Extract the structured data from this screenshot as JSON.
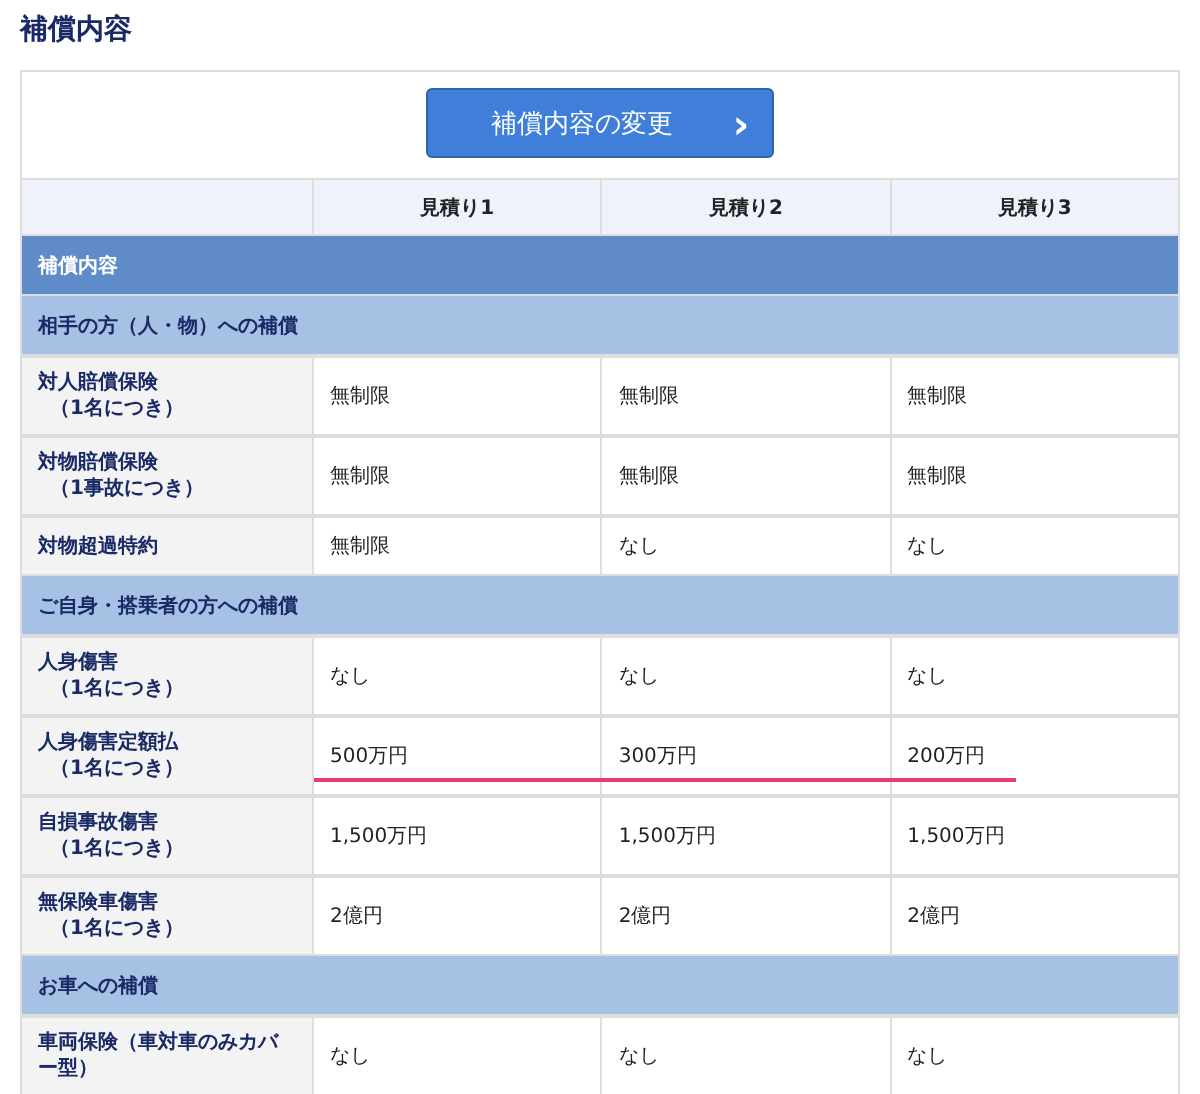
{
  "title": "補償内容",
  "change_button": {
    "label": "補償内容の変更",
    "icon": "›"
  },
  "columns": [
    "見積り1",
    "見積り2",
    "見積り3"
  ],
  "rows": [
    {
      "kind": "section",
      "label": "補償内容"
    },
    {
      "kind": "group",
      "label": "相手の方（人・物）への補償"
    },
    {
      "kind": "item",
      "label": "対人賠償保険",
      "note": "（1名につき）",
      "values": [
        "無制限",
        "無制限",
        "無制限"
      ]
    },
    {
      "kind": "item",
      "label": "対物賠償保険",
      "note": "（1事故につき）",
      "values": [
        "無制限",
        "無制限",
        "無制限"
      ]
    },
    {
      "kind": "item",
      "label": "対物超過特約",
      "values": [
        "無制限",
        "なし",
        "なし"
      ]
    },
    {
      "kind": "group",
      "label": "ご自身・搭乗者の方への補償"
    },
    {
      "kind": "item",
      "label": "人身傷害",
      "note": "（1名につき）",
      "values": [
        "なし",
        "なし",
        "なし"
      ]
    },
    {
      "kind": "item",
      "label": "人身傷害定額払",
      "note": "（1名につき）",
      "values": [
        "500万円",
        "300万円",
        "200万円"
      ],
      "underlined": true
    },
    {
      "kind": "item",
      "label": "自損事故傷害",
      "note": "（1名につき）",
      "values": [
        "1,500万円",
        "1,500万円",
        "1,500万円"
      ]
    },
    {
      "kind": "item",
      "label": "無保険車傷害",
      "note": "（1名につき）",
      "values": [
        "2億円",
        "2億円",
        "2億円"
      ]
    },
    {
      "kind": "group",
      "label": "お車への補償"
    },
    {
      "kind": "item",
      "label": "車両保険（車対車のみカバー型）",
      "values": [
        "なし",
        "なし",
        "なし"
      ]
    }
  ]
}
